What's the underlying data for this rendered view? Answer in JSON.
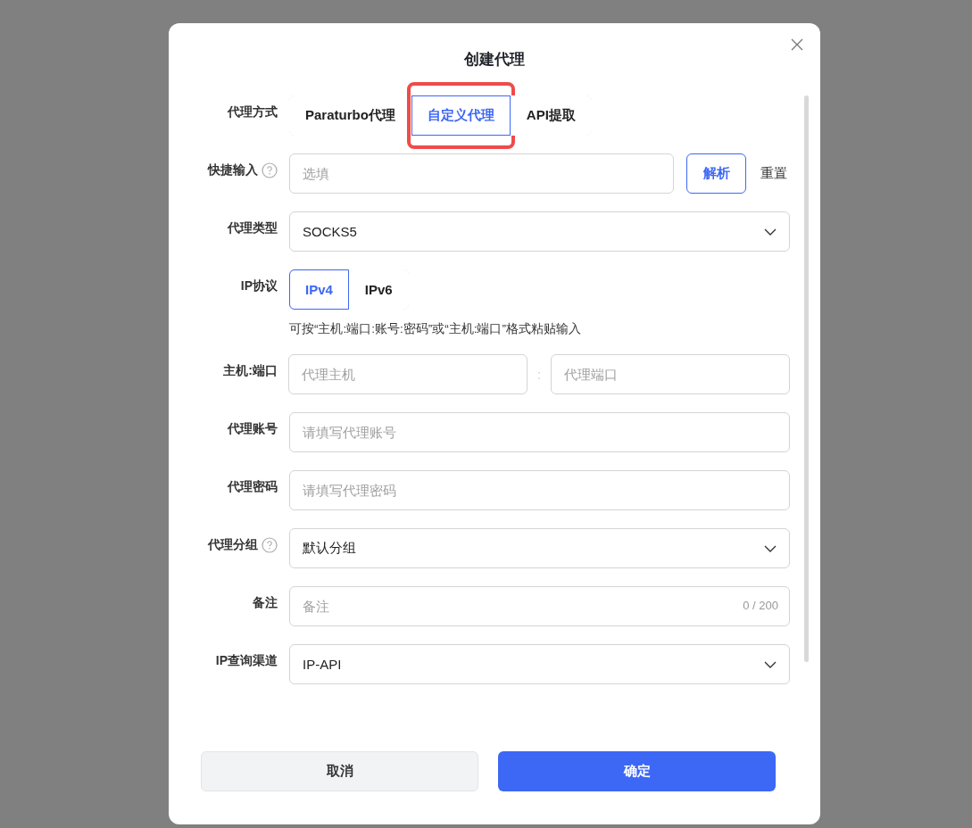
{
  "dialog": {
    "title": "创建代理",
    "fields": [
      {
        "kind": "segmented",
        "label": "代理方式",
        "help": false,
        "options": [
          {
            "label": "Paraturbo代理",
            "selected": false,
            "highlighted": false
          },
          {
            "label": "自定义代理",
            "selected": true,
            "highlighted": true
          },
          {
            "label": "API提取",
            "selected": false,
            "highlighted": false
          }
        ]
      },
      {
        "kind": "quick_input",
        "label": "快捷输入",
        "help": true,
        "placeholder": "选填",
        "action": "解析",
        "reset": "重置"
      },
      {
        "kind": "select",
        "label": "代理类型",
        "help": false,
        "value": "SOCKS5"
      },
      {
        "kind": "segmented",
        "label": "IP协议",
        "help": false,
        "options": [
          {
            "label": "IPv4",
            "selected": true,
            "highlighted": false
          },
          {
            "label": "IPv6",
            "selected": false,
            "highlighted": false
          }
        ]
      },
      {
        "kind": "hint",
        "text": "可按“主机:端口:账号:密码”或“主机:端口”格式粘贴输入"
      },
      {
        "kind": "host_port",
        "label": "主机:端口",
        "help": false,
        "host_placeholder": "代理主机",
        "separator": ":",
        "port_placeholder": "代理端口"
      },
      {
        "kind": "input",
        "label": "代理账号",
        "help": false,
        "placeholder": "请填写代理账号"
      },
      {
        "kind": "input",
        "label": "代理密码",
        "help": false,
        "placeholder": "请填写代理密码"
      },
      {
        "kind": "select",
        "label": "代理分组",
        "help": true,
        "value": "默认分组"
      },
      {
        "kind": "input",
        "label": "备注",
        "help": false,
        "placeholder": "备注",
        "counter": "0 / 200"
      },
      {
        "kind": "select",
        "label": "IP查询渠道",
        "help": false,
        "value": "IP-API"
      }
    ],
    "buttons": [
      {
        "label": "取消",
        "kind": "secondary"
      },
      {
        "label": "确定",
        "kind": "primary"
      }
    ]
  }
}
